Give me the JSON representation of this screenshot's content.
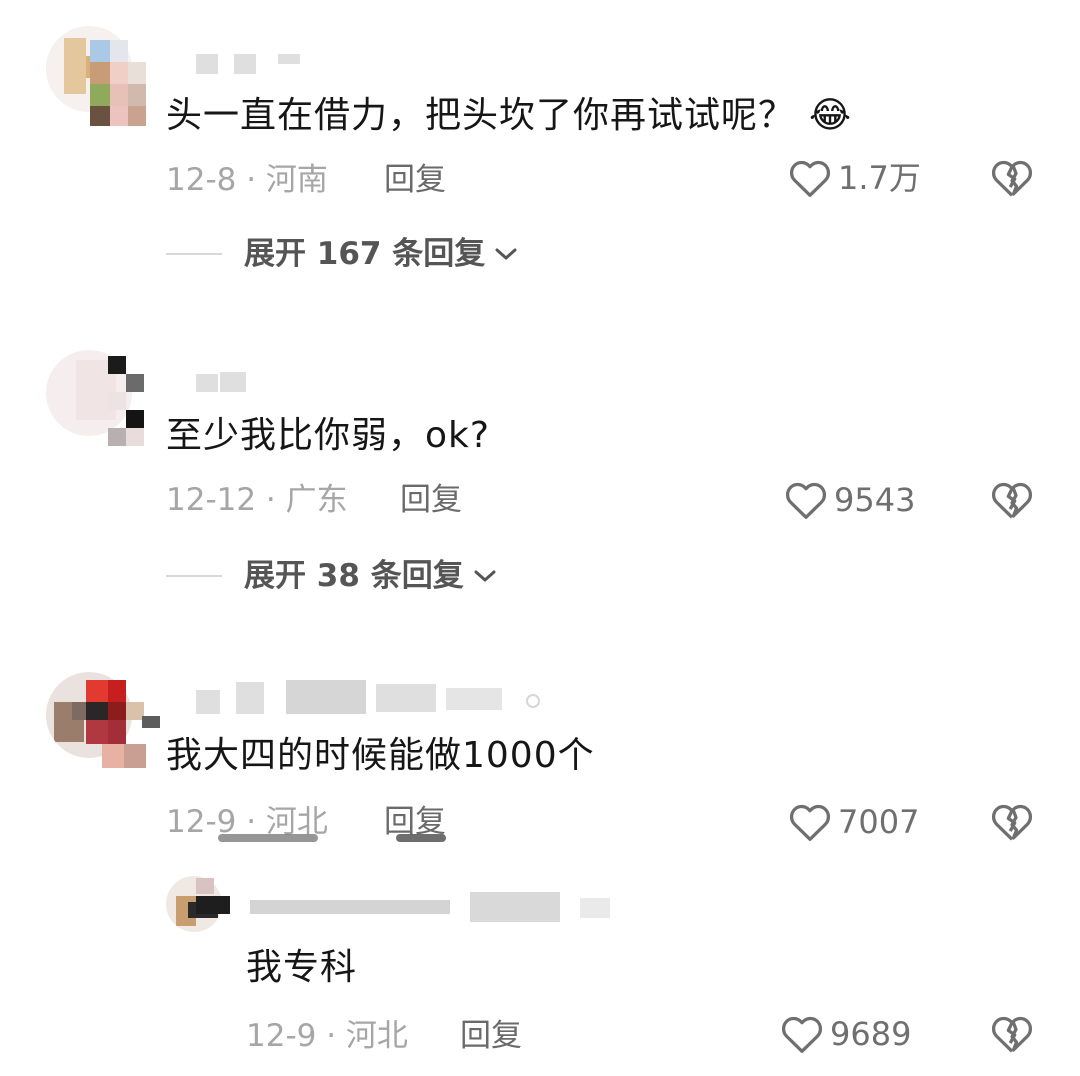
{
  "comments": [
    {
      "text": "头一直在借力，把头坎了你再试试呢？",
      "emoji": "😂",
      "date_loc": "12-8 · 河南",
      "reply_label": "回复",
      "likes": "1.7万",
      "expand_label": "展开 167 条回复"
    },
    {
      "text": "至少我比你弱，ok?",
      "date_loc": "12-12 · 广东",
      "reply_label": "回复",
      "likes": "9543",
      "expand_label": "展开 38 条回复"
    },
    {
      "text": "我大四的时候能做1000个",
      "date_loc": "12-9 · 河北",
      "reply_label": "回复",
      "likes": "7007",
      "sub_reply": {
        "text": "我专科",
        "date_loc": "12-9 · 河北",
        "reply_label": "回复",
        "likes": "9689"
      }
    }
  ],
  "icons": {
    "like": "heart-outline-icon",
    "dislike": "broken-heart-icon",
    "expand": "chevron-down-icon"
  },
  "colors": {
    "text": "#161616",
    "meta": "#a6a6a6",
    "action": "#6f6f6f"
  }
}
